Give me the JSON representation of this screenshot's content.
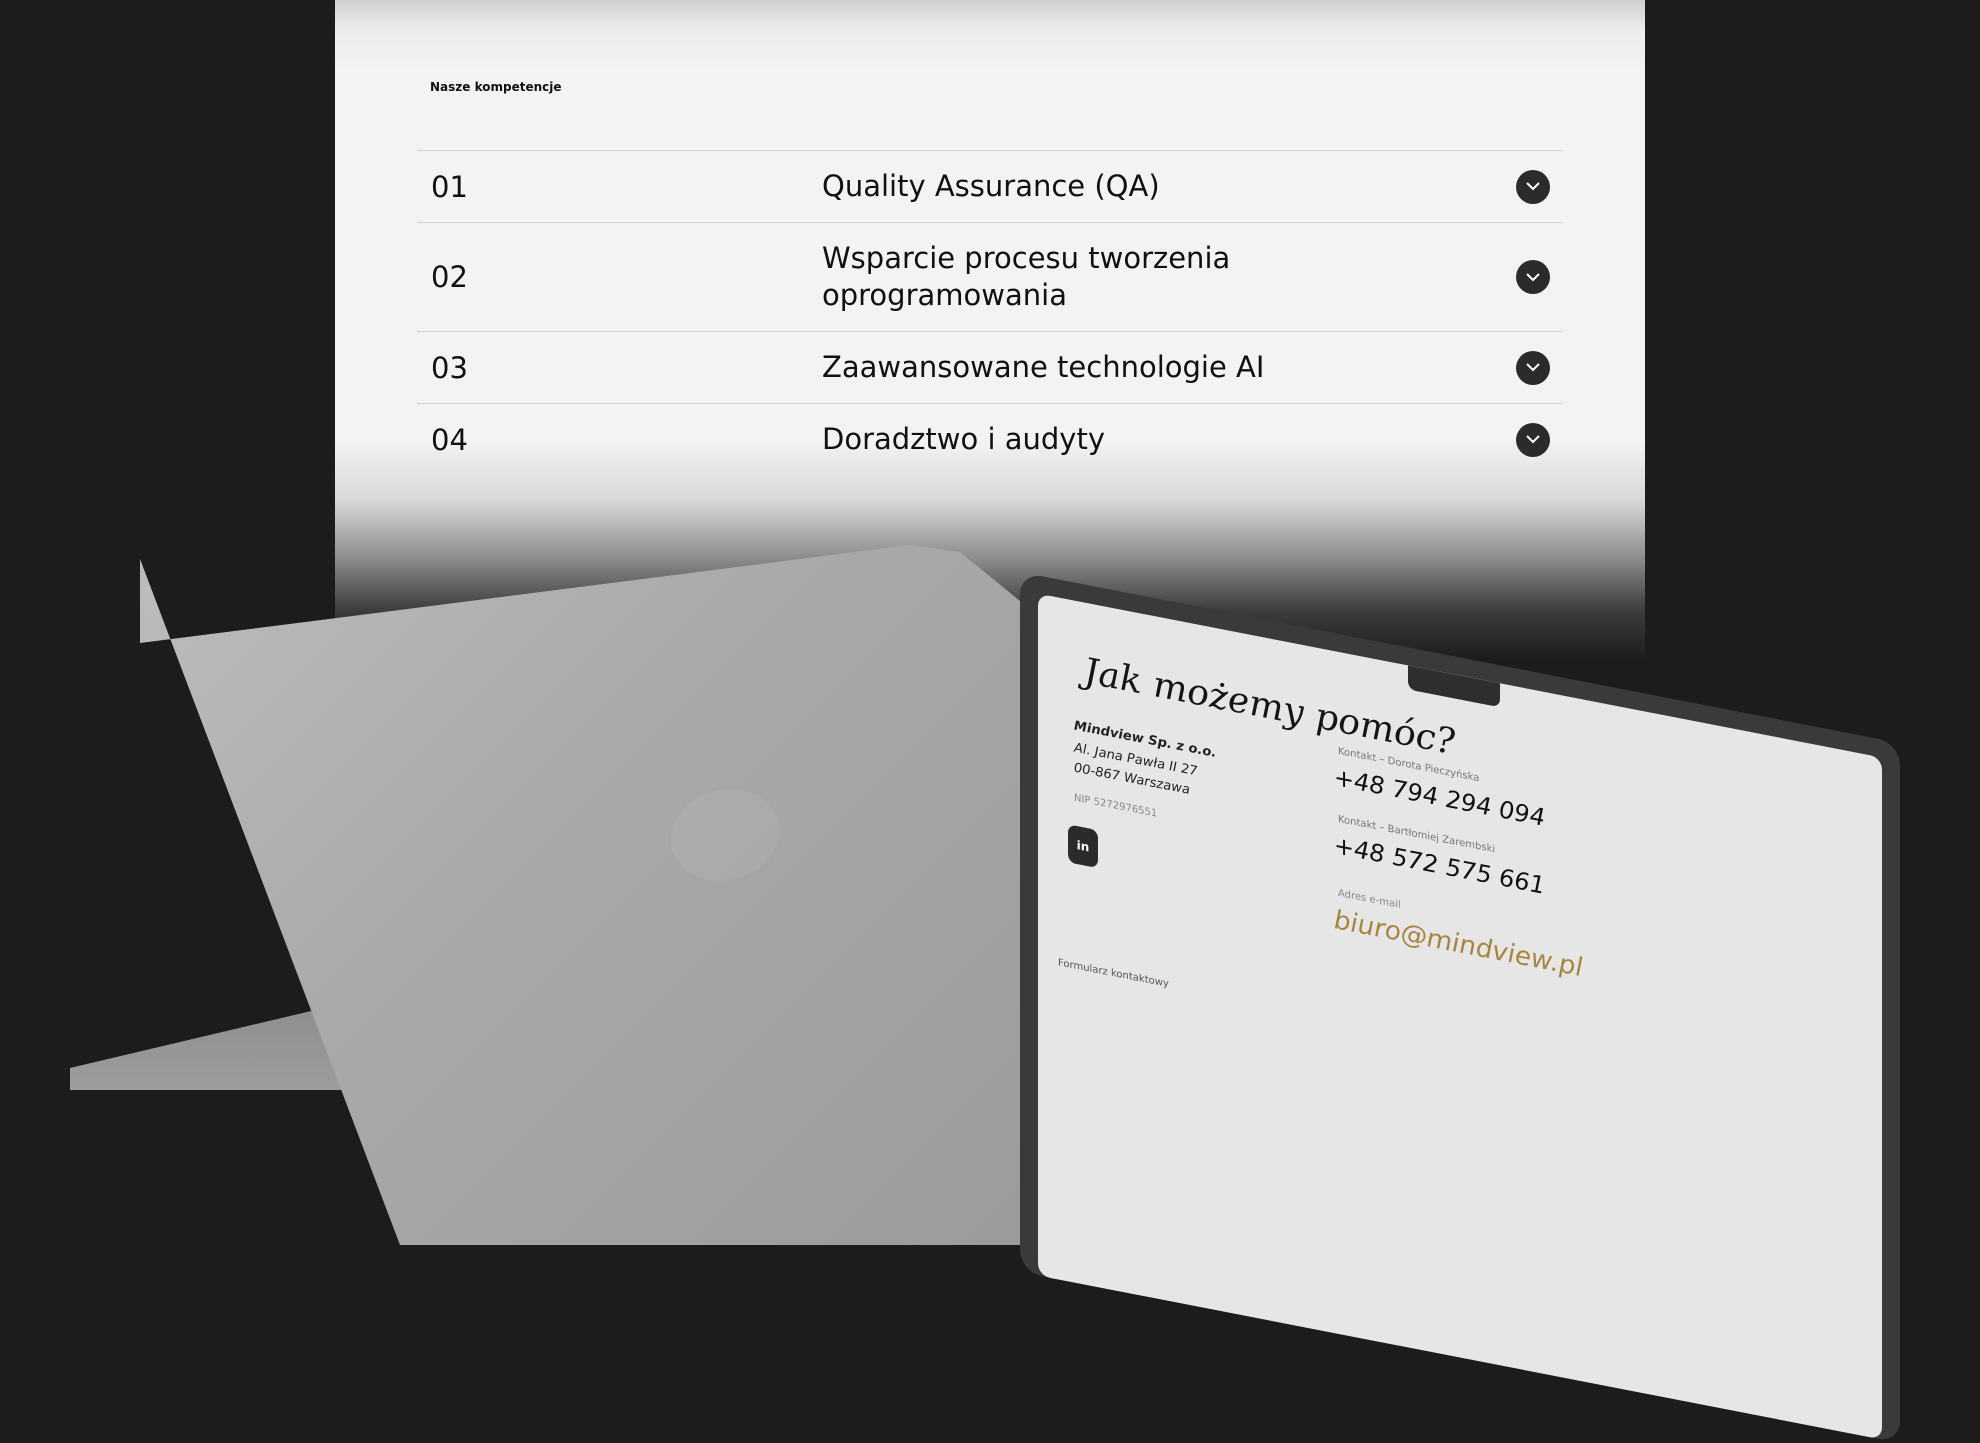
{
  "section": {
    "label": "Nasze kompetencje"
  },
  "accordion": [
    {
      "number": "01",
      "title": "Quality Assurance (QA)"
    },
    {
      "number": "02",
      "title": "Wsparcie procesu tworzenia oprogramowania"
    },
    {
      "number": "03",
      "title": "Zaawansowane technologie AI"
    },
    {
      "number": "04",
      "title": "Doradztwo i audyty"
    }
  ],
  "icons": {
    "toggle": "chevron-down-icon",
    "social": "linkedin-icon"
  },
  "colors": {
    "background": "#1c1c1c",
    "panel": "#f3f3f3",
    "accent": "#a8853f",
    "toggle_bg": "#2b2b2b"
  },
  "laptop_screen": {
    "heading": "Jak możemy pomóc?",
    "company": "Mindview Sp. z o.o.",
    "street": "Al. Jana Pawła II 27",
    "city": "00-867 Warszawa",
    "nip": "NIP 5272976551",
    "linkedin": "in",
    "contact1_label": "Kontakt – Dorota Pieczyńska",
    "contact1_phone": "+48 794 294 094",
    "contact2_label": "Kontakt – Bartłomiej Zarembski",
    "contact2_phone": "+48 572 575 661",
    "email_label": "Adres e-mail",
    "email": "biuro@mindview.pl",
    "form_label": "Formularz kontaktowy"
  }
}
